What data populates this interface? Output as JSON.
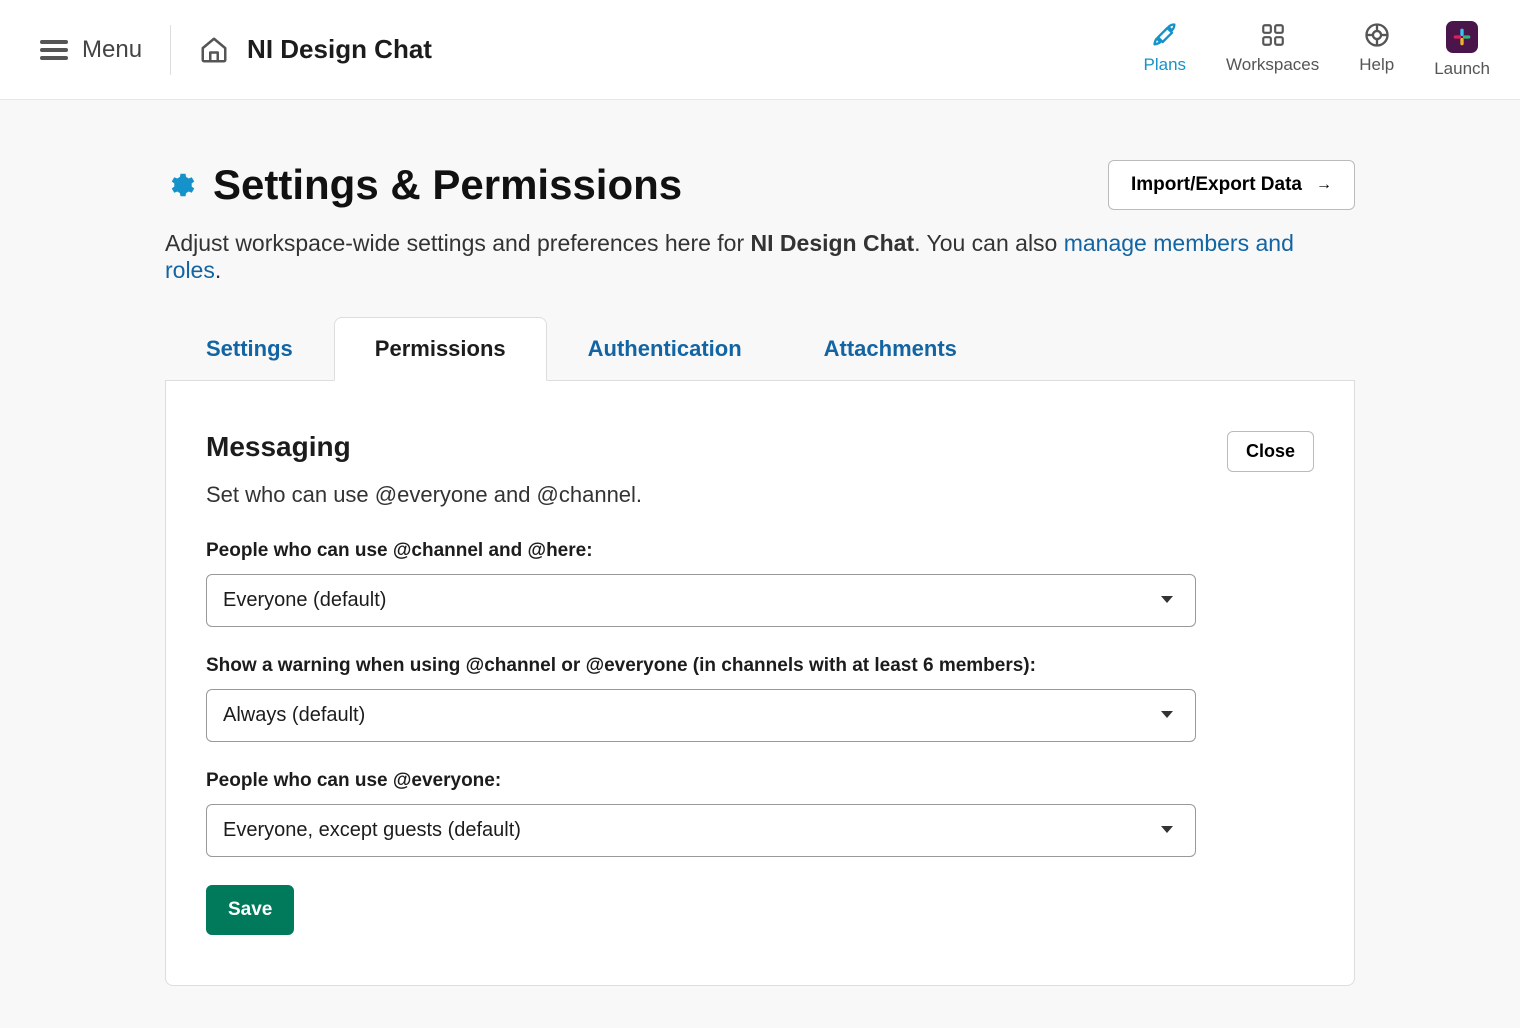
{
  "topbar": {
    "menu_label": "Menu",
    "workspace_name": "NI Design Chat",
    "nav": {
      "plans": "Plans",
      "workspaces": "Workspaces",
      "help": "Help",
      "launch": "Launch"
    }
  },
  "page": {
    "title": "Settings & Permissions",
    "import_btn": "Import/Export Data",
    "subtitle_prefix": "Adjust workspace-wide settings and preferences here for ",
    "subtitle_bold": "NI Design Chat",
    "subtitle_mid": ". You can also ",
    "manage_link": "manage members and roles",
    "subtitle_suffix": "."
  },
  "tabs": {
    "settings": "Settings",
    "permissions": "Permissions",
    "authentication": "Authentication",
    "attachments": "Attachments"
  },
  "section": {
    "title": "Messaging",
    "close": "Close",
    "desc": "Set who can use @everyone and @channel.",
    "field1_label": "People who can use @channel and @here:",
    "field1_value": "Everyone (default)",
    "field2_label": "Show a warning when using @channel or @everyone (in channels with at least 6 members):",
    "field2_value": "Always (default)",
    "field3_label": "People who can use @everyone:",
    "field3_value": "Everyone, except guests (default)",
    "save": "Save"
  }
}
